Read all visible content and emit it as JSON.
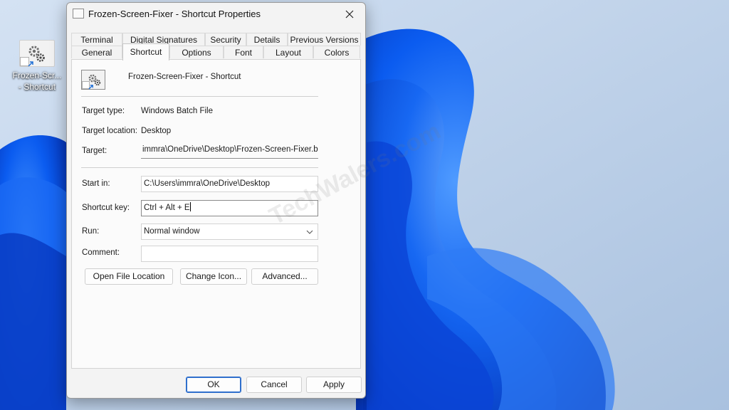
{
  "desktop": {
    "icon_label_line1": "Frozen-Scr...",
    "icon_label_line2": "- Shortcut",
    "watermark": "TechWalers.com"
  },
  "dialog": {
    "title": "Frozen-Screen-Fixer - Shortcut Properties",
    "tabs_row_top": [
      "Terminal",
      "Digital Signatures",
      "Security",
      "Details",
      "Previous Versions"
    ],
    "tabs_row_bottom": [
      "General",
      "Shortcut",
      "Options",
      "Font",
      "Layout",
      "Colors"
    ],
    "active_tab": "Shortcut",
    "shortcut_name": "Frozen-Screen-Fixer - Shortcut",
    "target_type": {
      "label": "Target type:",
      "value": "Windows Batch File"
    },
    "target_location": {
      "label": "Target location:",
      "value": "Desktop"
    },
    "target": {
      "label": "Target:",
      "value": "immra\\OneDrive\\Desktop\\Frozen-Screen-Fixer.bat"
    },
    "start_in": {
      "label": "Start in:",
      "value": "C:\\Users\\immra\\OneDrive\\Desktop"
    },
    "shortcut_key": {
      "label": "Shortcut key:",
      "value": "Ctrl + Alt + E"
    },
    "run": {
      "label": "Run:",
      "value": "Normal window"
    },
    "comment": {
      "label": "Comment:",
      "value": ""
    },
    "buttons": {
      "open_file_location": "Open File Location",
      "change_icon": "Change Icon...",
      "advanced": "Advanced..."
    },
    "footer": {
      "ok": "OK",
      "cancel": "Cancel",
      "apply": "Apply"
    }
  },
  "colors": {
    "wallpaper_light": "#c4d6ec",
    "bloom_blue": "#0a4fe0",
    "default_button_border": "#2f6fcc"
  }
}
